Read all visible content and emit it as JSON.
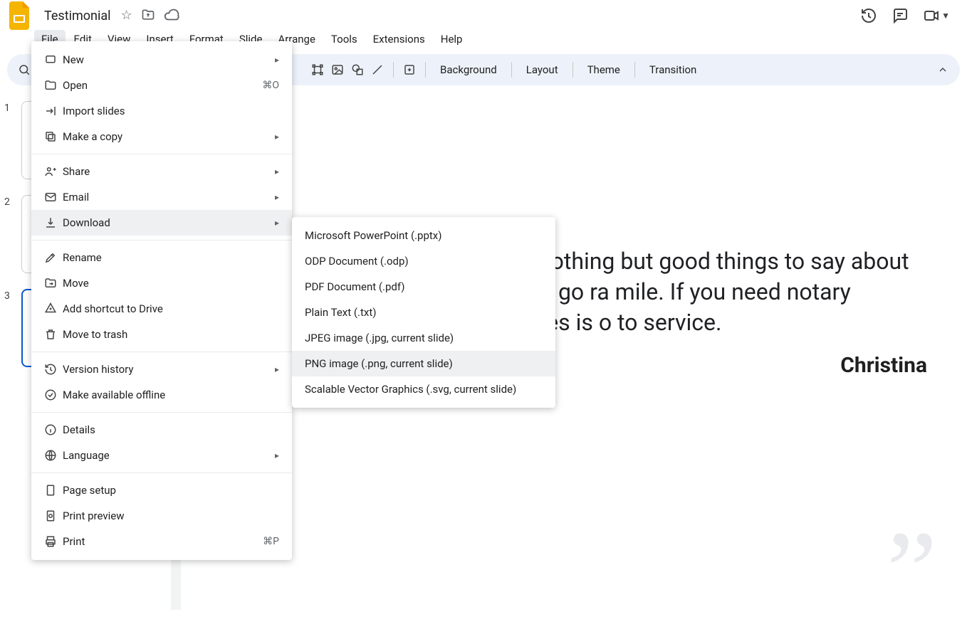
{
  "doc": {
    "title": "Testimonial"
  },
  "menus": {
    "items": [
      "File",
      "Edit",
      "View",
      "Insert",
      "Format",
      "Slide",
      "Arrange",
      "Tools",
      "Extensions",
      "Help"
    ]
  },
  "toolbar": {
    "background": "Background",
    "layout": "Layout",
    "theme": "Theme",
    "transition": "Transition"
  },
  "fileMenu": {
    "new": "New",
    "open": "Open",
    "open_kb": "⌘O",
    "import": "Import slides",
    "copy": "Make a copy",
    "share": "Share",
    "email": "Email",
    "download": "Download",
    "rename": "Rename",
    "move": "Move",
    "shortcut": "Add shortcut to Drive",
    "trash": "Move to trash",
    "history": "Version history",
    "offline": "Make available offline",
    "details": "Details",
    "language": "Language",
    "pagesetup": "Page setup",
    "preview": "Print preview",
    "print": "Print",
    "print_kb": "⌘P"
  },
  "downloadMenu": {
    "pptx": "Microsoft PowerPoint (.pptx)",
    "odp": "ODP Document (.odp)",
    "pdf": "PDF Document (.pdf)",
    "txt": "Plain Text (.txt)",
    "jpg": "JPEG image (.jpg, current slide)",
    "png": "PNG image (.png, current slide)",
    "svg": "Scalable Vector Graphics (.svg, current slide)"
  },
  "thumbs": {
    "n1": "1",
    "n2": "2",
    "n3": "3"
  },
  "slide": {
    "body": "ome! I have used Daniel's notary othing but good things to say about professional, polite and willing to go ra mile.  If you need notary services, Next Generation Notaries is o to service.",
    "author": "Christina",
    "qmark": "”"
  }
}
